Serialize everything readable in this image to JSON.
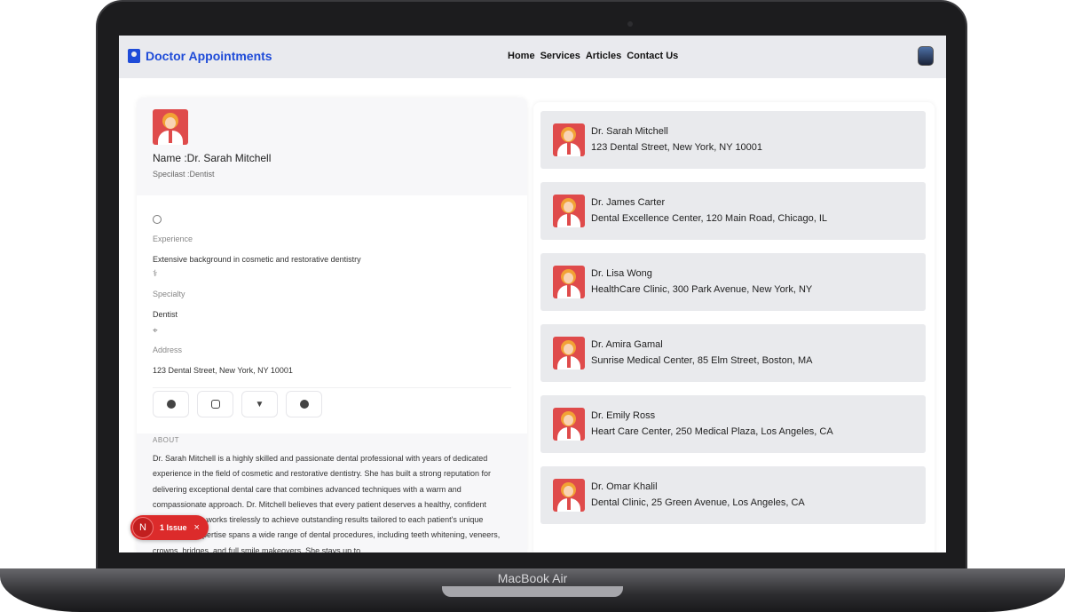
{
  "device": {
    "model_label": "MacBook Air"
  },
  "navbar": {
    "brand": "Doctor Appointments",
    "links": [
      "Home",
      "Services",
      "Articles",
      "Contact Us"
    ]
  },
  "profile": {
    "name": "Name :Dr. Sarah Mitchell",
    "specialist": "Specilast :Dentist",
    "experience_label": "Experience",
    "experience_value": "Extensive background in cosmetic and restorative dentistry",
    "specialty_label": "Specialty",
    "specialty_value": "Dentist",
    "address_label": "Address",
    "address_value": "123 Dental Street, New York, NY 10001",
    "about_label": "ABOUT",
    "about_text": "Dr. Sarah Mitchell is a highly skilled and passionate dental professional with years of dedicated experience in the field of cosmetic and restorative dentistry. She has built a strong reputation for delivering exceptional dental care that combines advanced techniques with a warm and compassionate approach. Dr. Mitchell believes that every patient deserves a healthy, confident smile, and she works tirelessly to achieve outstanding results tailored to each patient's unique needs. Her expertise spans a wide range of dental procedures, including teeth whitening, veneers, crowns, bridges, and full smile makeovers. She stays up to"
  },
  "social": [
    "facebook-icon",
    "instagram-icon",
    "twitter-icon",
    "github-icon"
  ],
  "doctors": [
    {
      "name": "Dr. Sarah Mitchell",
      "address": "123 Dental Street, New York, NY 10001"
    },
    {
      "name": "Dr. James Carter",
      "address": "Dental Excellence Center, 120 Main Road, Chicago, IL"
    },
    {
      "name": "Dr. Lisa Wong",
      "address": "HealthCare Clinic, 300 Park Avenue, New York, NY"
    },
    {
      "name": "Dr. Amira Gamal",
      "address": "Sunrise Medical Center, 85 Elm Street, Boston, MA"
    },
    {
      "name": "Dr. Emily Ross",
      "address": "Heart Care Center, 250 Medical Plaza, Los Angeles, CA"
    },
    {
      "name": "Dr. Omar Khalil",
      "address": "Dental Clinic, 25 Green Avenue, Los Angeles, CA"
    }
  ],
  "issue_badge": {
    "letter": "N",
    "text": "1 Issue",
    "close": "×"
  },
  "colors": {
    "brand": "#1e4bd8",
    "avatar_red": "#df4b4b",
    "issue_red": "#dc2b2b"
  }
}
